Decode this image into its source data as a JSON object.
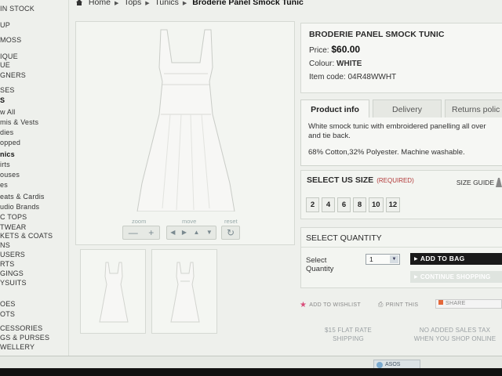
{
  "leftnav": {
    "items": [
      {
        "label": "IN STOCK",
        "style": "upper",
        "bold": false
      },
      {
        "label": "UP",
        "style": "upper",
        "bold": false
      },
      {
        "label": "MOSS",
        "style": "upper",
        "bold": false
      },
      {
        "label": "IQUE",
        "style": "upper",
        "bold": false
      },
      {
        "label": "UE",
        "style": "upper",
        "bold": false
      },
      {
        "label": "GNERS",
        "style": "upper",
        "bold": false
      },
      {
        "label": "SES",
        "style": "upper",
        "bold": false
      },
      {
        "label": "S",
        "style": "upper",
        "bold": true
      },
      {
        "label": "w All",
        "style": "mixed",
        "bold": false
      },
      {
        "label": "mis & Vests",
        "style": "mixed",
        "bold": false
      },
      {
        "label": "dies",
        "style": "mixed",
        "bold": false
      },
      {
        "label": "opped",
        "style": "mixed",
        "bold": false
      },
      {
        "label": "nics",
        "style": "mixed",
        "bold": true
      },
      {
        "label": "irts",
        "style": "mixed",
        "bold": false
      },
      {
        "label": "ouses",
        "style": "mixed",
        "bold": false
      },
      {
        "label": "es",
        "style": "mixed",
        "bold": false
      },
      {
        "label": "eats & Cardis",
        "style": "mixed",
        "bold": false
      },
      {
        "label": "udio Brands",
        "style": "mixed",
        "bold": false
      },
      {
        "label": "C TOPS",
        "style": "upper",
        "bold": false
      },
      {
        "label": "TWEAR",
        "style": "upper",
        "bold": false
      },
      {
        "label": "KETS & COATS",
        "style": "upper",
        "bold": false
      },
      {
        "label": "NS",
        "style": "upper",
        "bold": false
      },
      {
        "label": "USERS",
        "style": "upper",
        "bold": false
      },
      {
        "label": "RTS",
        "style": "upper",
        "bold": false
      },
      {
        "label": "GINGS",
        "style": "upper",
        "bold": false
      },
      {
        "label": "YSUITS",
        "style": "upper",
        "bold": false
      },
      {
        "label": "OES",
        "style": "upper",
        "bold": false
      },
      {
        "label": "OTS",
        "style": "upper",
        "bold": false
      },
      {
        "label": "CESSORIES",
        "style": "upper",
        "bold": false
      },
      {
        "label": "GS & PURSES",
        "style": "upper",
        "bold": false
      },
      {
        "label": "WELLERY",
        "style": "upper",
        "bold": false
      }
    ]
  },
  "breadcrumb": {
    "items": [
      "Home",
      "Tops",
      "Tunics"
    ],
    "current": "Broderie Panel Smock Tunic"
  },
  "image_viewer": {
    "zoom_label": "zoom",
    "move_label": "move",
    "reset_label": "reset",
    "zoom_minus": "—",
    "zoom_plus": "+",
    "move_left": "◀",
    "move_right": "▶",
    "move_up": "▲",
    "move_down": "▼",
    "reset_glyph": "↻"
  },
  "product": {
    "title": "BRODERIE PANEL SMOCK TUNIC",
    "price_label": "Price:",
    "price": "$60.00",
    "colour_label": "Colour:",
    "colour": "WHITE",
    "item_code_label": "Item code:",
    "item_code": "04R48WWHT"
  },
  "tabs": {
    "items": [
      "Product info",
      "Delivery",
      "Returns polic"
    ],
    "active_index": 0,
    "description": "White smock tunic with embroidered panelling all over and tie back.",
    "composition": "68% Cotton,32% Polyester. Machine washable."
  },
  "size": {
    "title": "SELECT US SIZE",
    "required": "(REQUIRED)",
    "guide": "SIZE GUIDE",
    "options": [
      "2",
      "4",
      "6",
      "8",
      "10",
      "12"
    ]
  },
  "quantity": {
    "title": "SELECT QUANTITY",
    "label": "Select Quantity",
    "value": "1",
    "add_to_bag": "ADD TO BAG",
    "continue_shopping": "CONTINUE SHOPPING"
  },
  "actions": {
    "wishlist": "ADD TO WISHLIST",
    "print": "PRINT THIS",
    "share": "SHARE"
  },
  "promos": {
    "shipping_line1": "$15 FLAT RATE",
    "shipping_line2": "SHIPPING",
    "tax_line1": "NO ADDED SALES TAX",
    "tax_line2": "WHEN YOU SHOP ONLINE"
  },
  "taskbar": {
    "button_text": "ASOS"
  },
  "colors": {
    "accent_required": "#b23a3a",
    "add_to_bag_bg": "#1a1a1a",
    "wishlist_star": "#d94d7a"
  }
}
